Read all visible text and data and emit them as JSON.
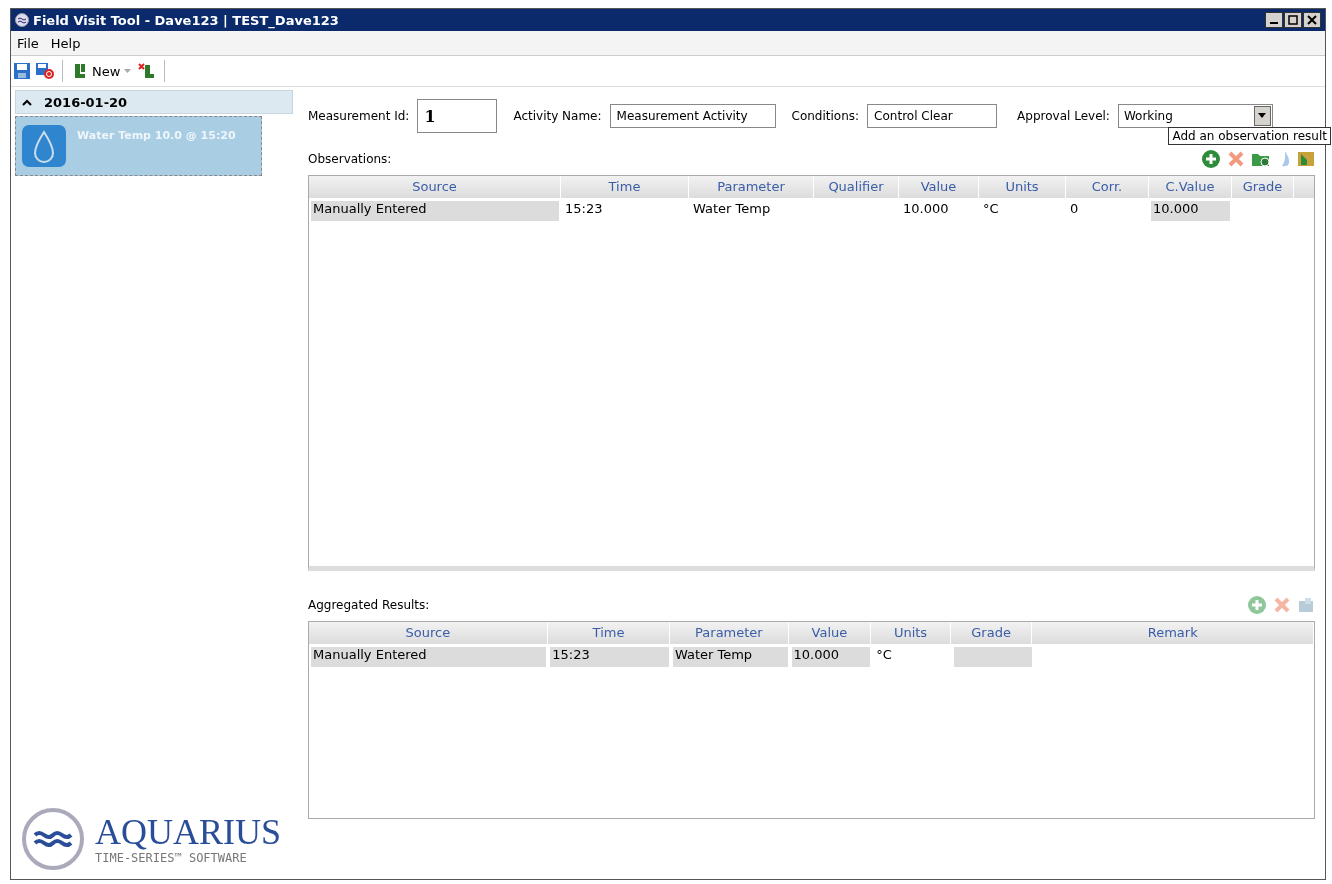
{
  "window": {
    "title": "Field Visit Tool - Dave123 | TEST_Dave123"
  },
  "menu": [
    "File",
    "Help"
  ],
  "toolbar": {
    "new_label": "New"
  },
  "sidebar": {
    "group": {
      "label": "2016-01-20",
      "expanded": true
    },
    "items": [
      {
        "label": "Water Temp 10.0 @ 15:20",
        "selected": true
      }
    ],
    "logo": {
      "name": "AQUARIUS",
      "tagline": "TIME-SERIES™ SOFTWARE"
    }
  },
  "form": {
    "measurement_id": {
      "label": "Measurement Id:",
      "value": "1"
    },
    "activity_name": {
      "label": "Activity Name:",
      "value": "Measurement Activity"
    },
    "conditions": {
      "label": "Conditions:",
      "value": "Control Clear"
    },
    "approval_level": {
      "label": "Approval Level:",
      "value": "Working"
    }
  },
  "observations": {
    "title": "Observations:",
    "tooltip": "Add an observation result",
    "columns": [
      {
        "label": "Source"
      },
      {
        "label": "Time"
      },
      {
        "label": "Parameter"
      },
      {
        "label": "Qualifier"
      },
      {
        "label": "Value"
      },
      {
        "label": "Units"
      },
      {
        "label": "Corr."
      },
      {
        "label": "C.Value"
      },
      {
        "label": "Grade"
      }
    ],
    "rows": [
      [
        {
          "text": "Manually Entered",
          "readonly": true
        },
        {
          "text": "15:23",
          "readonly": false
        },
        {
          "text": "Water Temp",
          "readonly": false
        },
        {
          "readonly": false
        },
        {
          "text": "10.000",
          "readonly": false
        },
        {
          "text": "°C",
          "readonly": false
        },
        {
          "text": "0",
          "readonly": false
        },
        {
          "text": "10.000",
          "readonly": true
        },
        {
          "readonly": false
        }
      ]
    ]
  },
  "aggregated": {
    "title": "Aggregated Results:",
    "columns": [
      {
        "label": "Source"
      },
      {
        "label": "Time"
      },
      {
        "label": "Parameter"
      },
      {
        "label": "Value"
      },
      {
        "label": "Units"
      },
      {
        "label": "Grade"
      },
      {
        "label": "Remark"
      }
    ],
    "rows": [
      [
        {
          "text": "Manually Entered",
          "readonly": true
        },
        {
          "text": "15:23",
          "readonly": true
        },
        {
          "text": "Water Temp",
          "readonly": true
        },
        {
          "text": "10.000",
          "readonly": true
        },
        {
          "text": "°C",
          "readonly": false
        },
        {
          "readonly": true
        },
        {
          "readonly": false
        }
      ]
    ]
  }
}
